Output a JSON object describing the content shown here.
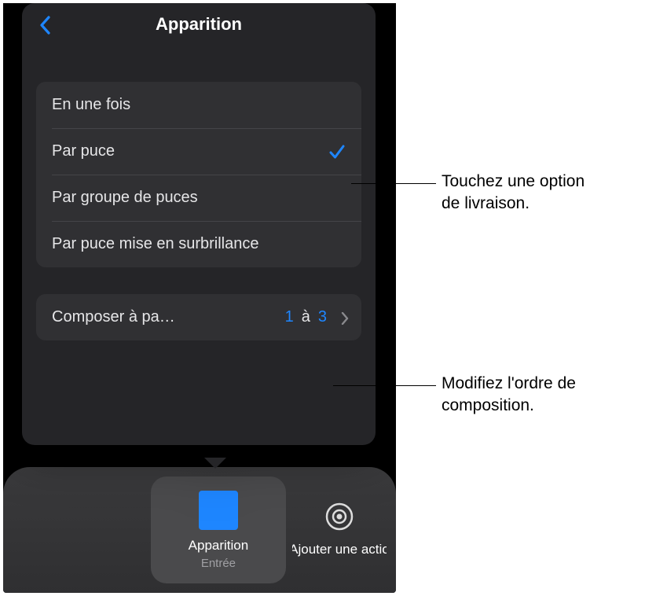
{
  "nav": {
    "title": "Apparition"
  },
  "options": [
    {
      "label": "En une fois",
      "selected": false
    },
    {
      "label": "Par puce",
      "selected": true
    },
    {
      "label": "Par groupe de puces",
      "selected": false
    },
    {
      "label": "Par puce mise en surbrillance",
      "selected": false
    }
  ],
  "compose": {
    "label": "Composer à pa…",
    "from": "1",
    "separator": "à",
    "to": "3"
  },
  "bottomBar": {
    "tile1": {
      "title": "Apparition",
      "subtitle": "Entrée"
    },
    "tile2": {
      "title": "Ajouter une actio"
    }
  },
  "callouts": {
    "c1": {
      "line1": "Touchez une option",
      "line2": "de livraison."
    },
    "c2": {
      "line1": "Modifiez l'ordre de",
      "line2": "composition."
    }
  },
  "colors": {
    "accent": "#1e86ff"
  }
}
